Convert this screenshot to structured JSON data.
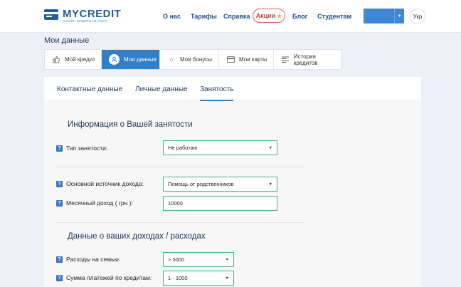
{
  "header": {
    "logo_word": "MYCREDIT",
    "logo_tagline": "онлайн кредиты на карту",
    "nav": [
      "О нас",
      "Тарифы",
      "Справка"
    ],
    "promo_label": "Акции",
    "nav_after": [
      "Блог",
      "Студентам"
    ],
    "lang": "Укр"
  },
  "page": {
    "title": "Мои данные"
  },
  "tabs": [
    {
      "label": "Мой кредит",
      "icon": "thumb-icon"
    },
    {
      "label": "Мои данные",
      "icon": "user-icon",
      "active": true
    },
    {
      "label": "Мои бонусы",
      "icon": "star-icon"
    },
    {
      "label": "Мои карты",
      "icon": "card-icon"
    },
    {
      "label": "История кредитов",
      "icon": "list-icon"
    }
  ],
  "subtabs": [
    "Контактные данные",
    "Личные данные",
    "Занятость"
  ],
  "sections": {
    "employment_title": "Информация о Вашей занятости",
    "finance_title": "Данные о ваших доходах / расходах"
  },
  "fields": {
    "employment_type": {
      "label": "Тип занятости:",
      "value": "Не работаю"
    },
    "income_source": {
      "label": "Основной источник дохода:",
      "value": "Помощь от родственников"
    },
    "monthly_income": {
      "label": "Месячный доход ( грн ):",
      "value": "10000"
    },
    "family_expenses": {
      "label": "Расходы на семью:",
      "value": "> 5000"
    },
    "loan_payments": {
      "label": "Сумма платежей по кредитам:",
      "value": "1 - 1000"
    }
  },
  "help_mark": "?",
  "colors": {
    "brand": "#1d5fa3",
    "accent": "#2f7fc9",
    "field_border": "#45b08c",
    "promo": "#d23d3d"
  }
}
